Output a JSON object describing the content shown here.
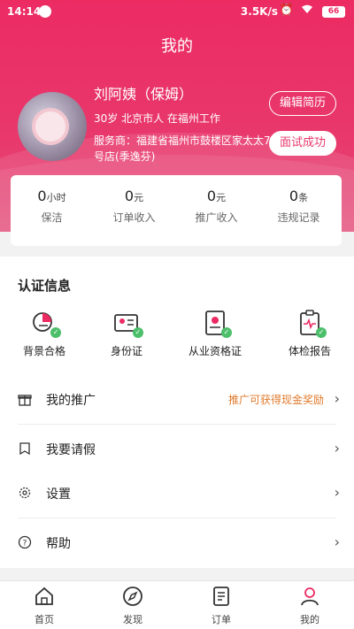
{
  "status_bar": {
    "time": "14:14",
    "speed": "3.5K/s",
    "battery": "66"
  },
  "page": {
    "title": "我的"
  },
  "profile": {
    "name": "刘阿姨（保姆）",
    "subinfo": "30岁  北京市人  在福州工作",
    "agency": "服务商：福建省福州市鼓楼区家太太7号店(季逸芬)",
    "edit_button": "编辑简历",
    "status_button": "面试成功"
  },
  "stats": [
    {
      "value": "0",
      "unit": "小时",
      "label": "保洁"
    },
    {
      "value": "0",
      "unit": "元",
      "label": "订单收入"
    },
    {
      "value": "0",
      "unit": "元",
      "label": "推广收入"
    },
    {
      "value": "0",
      "unit": "条",
      "label": "违规记录"
    }
  ],
  "certification": {
    "title": "认证信息",
    "items": [
      {
        "label": "背景合格",
        "icon": "background-check-icon"
      },
      {
        "label": "身份证",
        "icon": "id-card-icon"
      },
      {
        "label": "从业资格证",
        "icon": "qualification-icon"
      },
      {
        "label": "体检报告",
        "icon": "medical-report-icon"
      }
    ]
  },
  "menu": {
    "promotion": {
      "label": "我的推广",
      "hint": "推广可获得现金奖励",
      "icon": "gift-icon"
    },
    "leave": {
      "label": "我要请假",
      "icon": "leave-icon"
    },
    "settings": {
      "label": "设置",
      "icon": "gear-icon"
    },
    "help": {
      "label": "帮助",
      "icon": "help-icon"
    }
  },
  "tabs": [
    {
      "label": "首页",
      "icon": "home-icon"
    },
    {
      "label": "发现",
      "icon": "compass-icon"
    },
    {
      "label": "订单",
      "icon": "order-icon"
    },
    {
      "label": "我的",
      "icon": "user-icon"
    }
  ],
  "colors": {
    "accent": "#ec2b63",
    "hint": "#e07a2c",
    "check": "#4cbf6a"
  }
}
